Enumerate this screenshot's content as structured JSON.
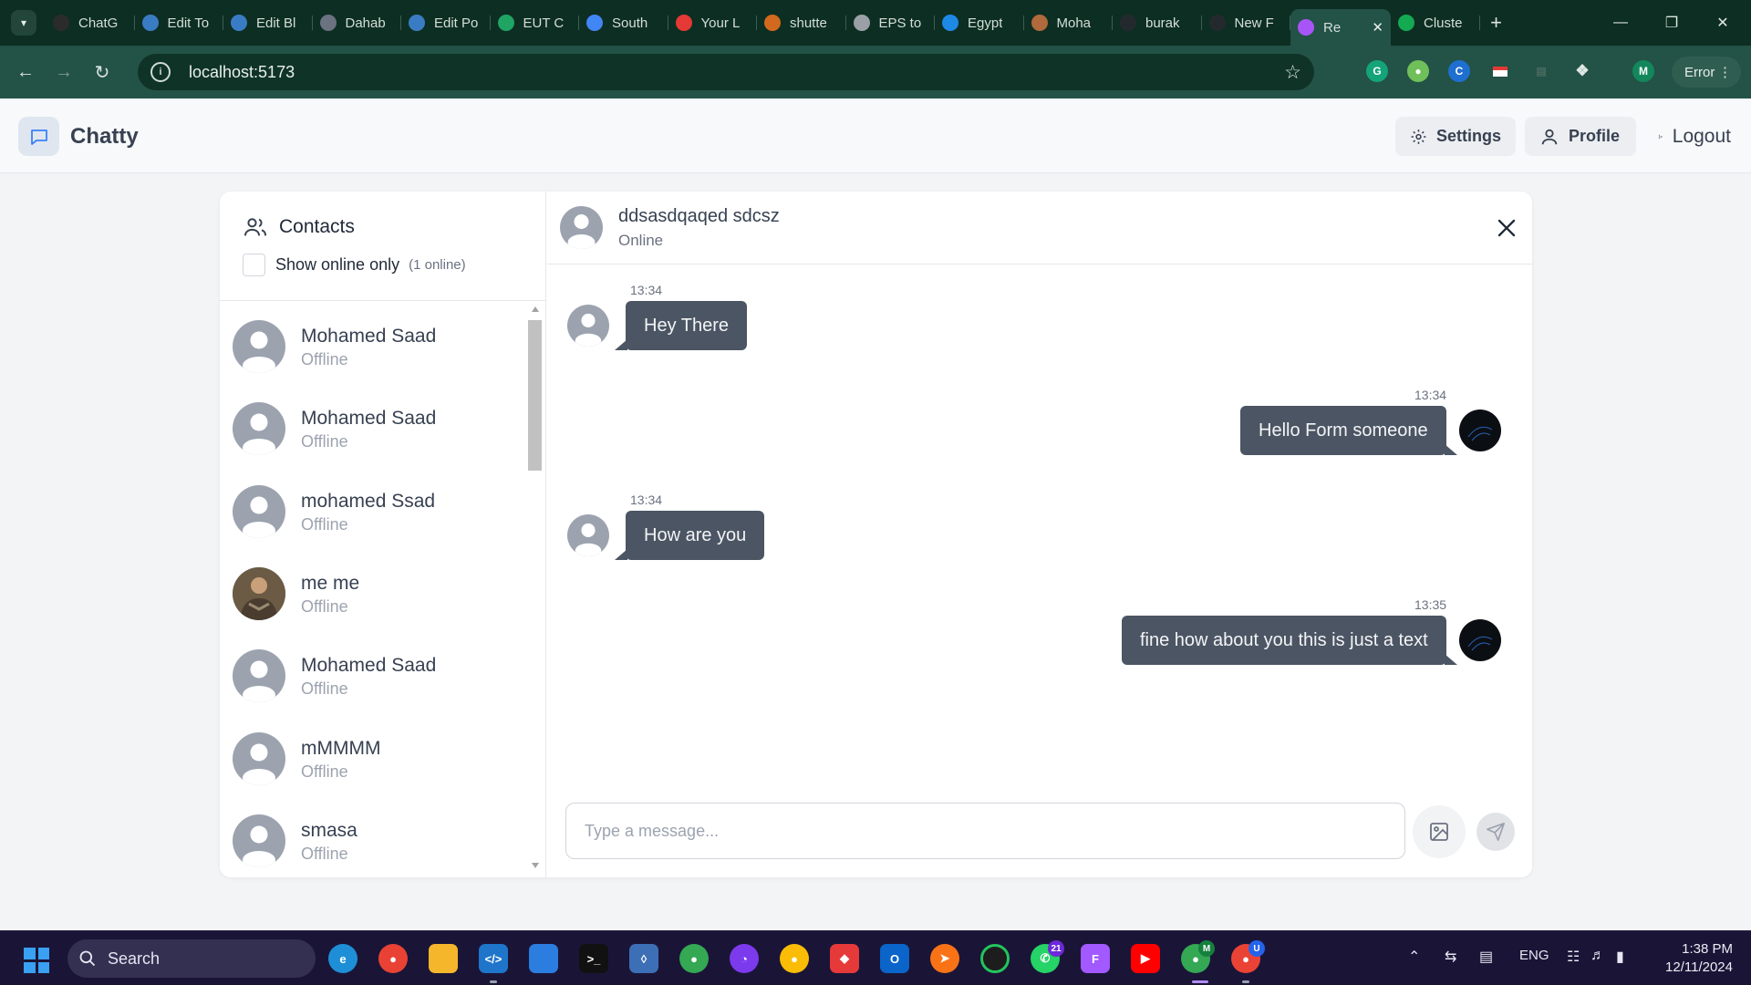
{
  "browser": {
    "tabs": [
      {
        "label": "ChatG",
        "icon": "chatgpt-icon",
        "color": "#2b2b2b"
      },
      {
        "label": "Edit To",
        "icon": "wordpress-icon",
        "color": "#3a7cc4"
      },
      {
        "label": "Edit Bl",
        "icon": "wordpress-icon",
        "color": "#3a7cc4"
      },
      {
        "label": "Dahab",
        "icon": "globe-icon",
        "color": "#6b7280"
      },
      {
        "label": "Edit Po",
        "icon": "wordpress-icon",
        "color": "#3a7cc4"
      },
      {
        "label": "EUT C",
        "icon": "sheets-icon",
        "color": "#1fa463"
      },
      {
        "label": "South",
        "icon": "google-icon",
        "color": "#4285f4"
      },
      {
        "label": "Your L",
        "icon": "app-red-icon",
        "color": "#e53935"
      },
      {
        "label": "shutte",
        "icon": "shutterstock-icon",
        "color": "#d2691e"
      },
      {
        "label": "EPS to",
        "icon": "cloud-icon",
        "color": "#9aa0a6"
      },
      {
        "label": "Egypt",
        "icon": "plane-icon",
        "color": "#1e88e5"
      },
      {
        "label": "Moha",
        "icon": "person-avatar-icon",
        "color": "#b06a3b"
      },
      {
        "label": "burak",
        "icon": "github-icon",
        "color": "#24292e"
      },
      {
        "label": "New F",
        "icon": "github-icon",
        "color": "#24292e"
      },
      {
        "label": "Re",
        "icon": "vite-icon",
        "color": "#a855f7",
        "active": true
      },
      {
        "label": "Cluste",
        "icon": "mongodb-leaf-icon",
        "color": "#13aa52"
      }
    ],
    "url": "localhost:5173",
    "error_chip": "Error",
    "profile_initial": "M"
  },
  "app": {
    "brand": "Chatty",
    "nav": {
      "settings": "Settings",
      "profile": "Profile",
      "logout": "Logout"
    }
  },
  "sidebar": {
    "title": "Contacts",
    "filter_label": "Show online only",
    "online_count": "(1 online)",
    "contacts": [
      {
        "name": "Mohamed Saad",
        "status": "Offline",
        "avatar": "default"
      },
      {
        "name": "Mohamed Saad",
        "status": "Offline",
        "avatar": "default"
      },
      {
        "name": "mohamed Ssad",
        "status": "Offline",
        "avatar": "default"
      },
      {
        "name": "me me",
        "status": "Offline",
        "avatar": "photo"
      },
      {
        "name": "Mohamed Saad",
        "status": "Offline",
        "avatar": "default"
      },
      {
        "name": "mMMMM",
        "status": "Offline",
        "avatar": "default"
      },
      {
        "name": "smasa",
        "status": "Offline",
        "avatar": "default"
      }
    ]
  },
  "chat": {
    "name": "ddsasdqaqed sdcsz",
    "status": "Online",
    "messages": [
      {
        "side": "left",
        "time": "13:34",
        "text": "Hey There"
      },
      {
        "side": "right",
        "time": "13:34",
        "text": "Hello Form someone"
      },
      {
        "side": "left",
        "time": "13:34",
        "text": "How are you"
      },
      {
        "side": "right",
        "time": "13:35",
        "text": "fine how about you this is just a text"
      }
    ],
    "input_placeholder": "Type a message..."
  },
  "taskbar": {
    "search_label": "Search",
    "badges": {
      "whatsapp": "21",
      "chrome_profile_m": "M",
      "chrome_profile_u": "U"
    },
    "language": "ENG",
    "time": "1:38 PM",
    "date": "12/11/2024"
  },
  "colors": {
    "chrome_dark": "#0d2e22",
    "chrome_toolbar": "#235246",
    "bubble": "#4b5563",
    "page_bg": "#f3f4f6",
    "taskbar": "#1a1537"
  }
}
